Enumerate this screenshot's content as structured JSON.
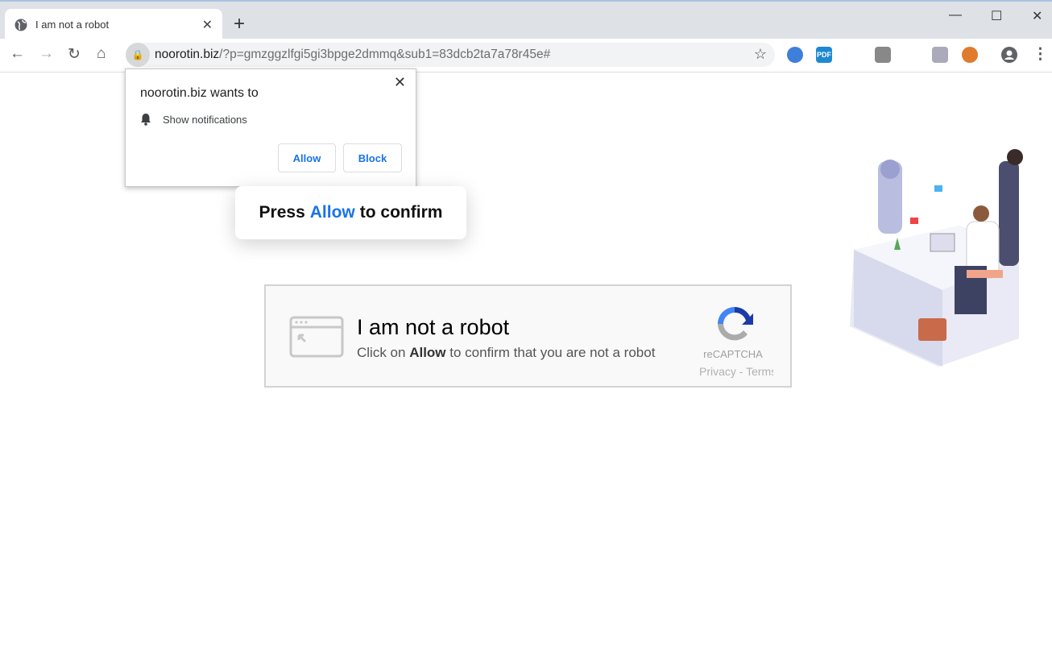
{
  "browser": {
    "tab_title": "I am not a robot",
    "url_host": "noorotin.biz",
    "url_rest": "/?p=gmzggzlfgi5gi3bpge2dmmq&sub1=83dcb2ta7a78r45e#",
    "extensions": [
      "globe-ext",
      "pdf-ext",
      "radio-ext",
      "book-ext",
      "bag-ext"
    ],
    "pdf_label": "PDF"
  },
  "popup": {
    "title": "noorotin.biz wants to",
    "permission": "Show notifications",
    "allow": "Allow",
    "block": "Block"
  },
  "press": {
    "before": "Press",
    "allow": "Allow",
    "after": "to confirm"
  },
  "captcha": {
    "heading": "I am not a robot",
    "sub_before": "Click on",
    "sub_bold": "Allow",
    "sub_after": "to confirm that you are not a robot",
    "brand": "reCAPTCHA",
    "links": "Privacy - Terms"
  },
  "colors": {
    "accent": "#1a73e8",
    "tabstrip": "#dee1e6"
  }
}
